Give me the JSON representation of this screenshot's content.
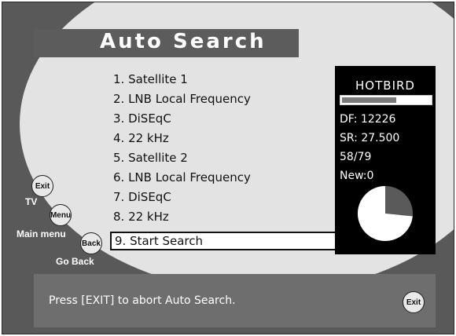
{
  "title": "Auto Search",
  "menu": {
    "items": [
      {
        "label": "1. Satellite 1"
      },
      {
        "label": "2. LNB Local Frequency"
      },
      {
        "label": "3. DiSEqC"
      },
      {
        "label": "4. 22 kHz"
      },
      {
        "label": "5. Satellite 2"
      },
      {
        "label": "6. LNB Local Frequency"
      },
      {
        "label": "7. DiSEqC"
      },
      {
        "label": "8. 22 kHz"
      },
      {
        "label": "9. Start Search"
      }
    ],
    "selected_index": 8
  },
  "info": {
    "satellite": "HOTBIRD",
    "signal_level": 0.62,
    "df": "DF: 12226",
    "sr": "SR: 27.500",
    "progress": "58/79",
    "new": "New:0",
    "pie_fraction": 0.734
  },
  "nav": {
    "exit_button": "Exit",
    "exit_label": "TV",
    "menu_button": "Menu",
    "menu_label": "Main menu",
    "back_button": "Back",
    "back_label": "Go Back"
  },
  "footer": {
    "text": "Press [EXIT] to abort Auto Search.",
    "exit_button": "Exit"
  },
  "colors": {
    "background": "#595959",
    "ellipse": "#e3e3e3",
    "panel": "#000000",
    "pie_done": "#ffffff",
    "pie_remaining": "#5a5a5a"
  }
}
